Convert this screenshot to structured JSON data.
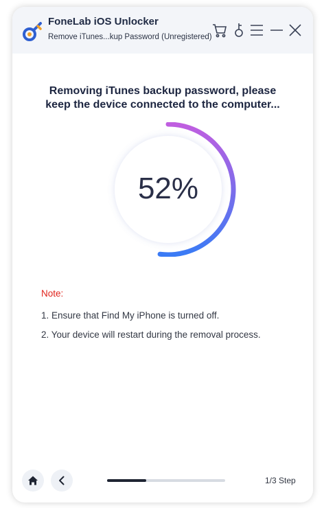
{
  "app": {
    "title": "FoneLab iOS Unlocker",
    "subtitle": "Remove iTunes...kup Password  (Unregistered)"
  },
  "toolbar": {
    "icons": [
      "cart-icon",
      "key-icon",
      "menu-icon",
      "minimize-icon",
      "close-icon"
    ]
  },
  "main": {
    "heading_line1": "Removing iTunes backup password, please",
    "heading_line2": "keep the device connected to the computer...",
    "progress_percent": 52,
    "progress_label": "52%"
  },
  "note": {
    "label": "Note:",
    "items": [
      "1. Ensure that Find My iPhone is turned off.",
      "2. Your device will restart during the removal process."
    ]
  },
  "footer": {
    "step_label": "1/3 Step",
    "step_current": 1,
    "step_total": 3
  },
  "colors": {
    "note_red": "#e0231c",
    "ring_gradient_start": "#3a7bf5",
    "ring_gradient_end": "#c05ee0"
  }
}
